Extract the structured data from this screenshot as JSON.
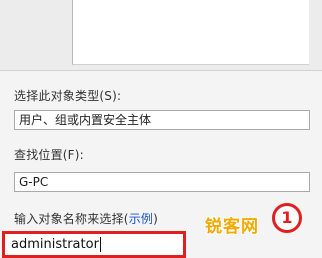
{
  "dialog": {
    "object_type_label": "选择此对象类型(S):",
    "object_type_value": "用户、组或内置安全主体",
    "location_label": "查找位置(F):",
    "location_value": "G-PC",
    "enter_names_label": "输入对象名称来选择(",
    "examples_link": "示例",
    "enter_names_label_end": ")",
    "object_names_value": "administrator"
  },
  "annotation": {
    "step_number": "1",
    "accent_color": "#e0201e"
  },
  "watermark": {
    "text": "锐客网"
  }
}
